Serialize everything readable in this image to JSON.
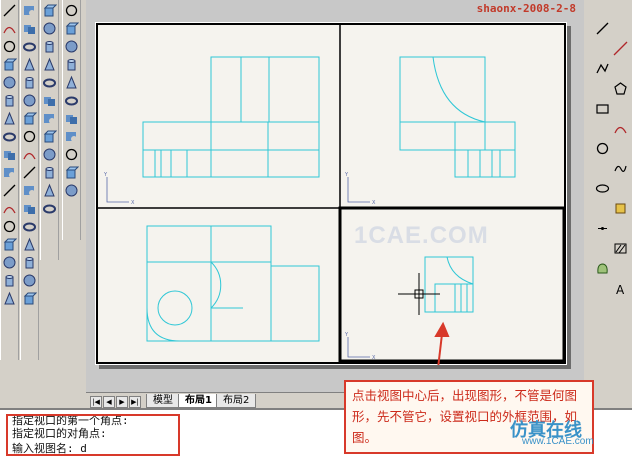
{
  "watermark": {
    "author": "shaonx-2008-2-8",
    "site": "1CAE.COM"
  },
  "tabs": {
    "items": [
      {
        "label": "模型"
      },
      {
        "label": "布局1"
      },
      {
        "label": "布局2"
      }
    ],
    "nav": [
      "|◀",
      "◀",
      "▶",
      "▶|"
    ]
  },
  "command": {
    "lines": [
      "指定视口的第一个角点:",
      "指定视口的对角点:",
      "输入视图名: d"
    ]
  },
  "callout": {
    "text": "点击视图中心后，出现图形，不管是何图形，先不管它，设置视口的外框范围，如图。"
  },
  "logo": {
    "text": "仿真在线",
    "sub": "www.1CAE.com"
  },
  "colors": {
    "drawing_line": "#2fc7d6",
    "accent": "#d8392a",
    "paper": "#ffffff",
    "background": "#c8c8c8"
  },
  "icons": {
    "left_toolbar": [
      "line-icon",
      "arc-icon",
      "circle-icon",
      "box-icon",
      "sphere-icon",
      "cylinder-icon",
      "cone-icon",
      "torus-icon",
      "union-icon",
      "subtract-icon"
    ],
    "right_toolbar": [
      "line-icon",
      "xline-icon",
      "polyline-icon",
      "polygon-icon",
      "rectangle-icon",
      "arc-icon",
      "circle-icon",
      "spline-icon",
      "ellipse-icon",
      "insert-icon",
      "point-icon",
      "hatch-icon",
      "region-icon",
      "text-icon"
    ]
  }
}
